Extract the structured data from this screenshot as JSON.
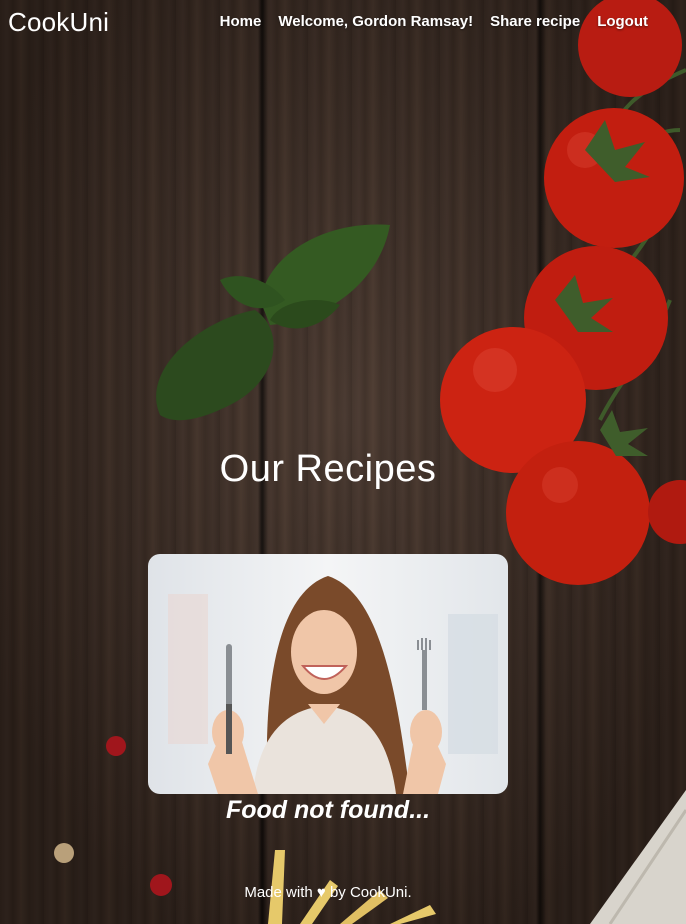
{
  "brand": "CookUni",
  "nav": {
    "home": "Home",
    "welcome": "Welcome, Gordon Ramsay!",
    "share": "Share recipe",
    "logout": "Logout"
  },
  "title": "Our Recipes",
  "message": "Food not found...",
  "footer": "Made with ♥ by CookUni."
}
